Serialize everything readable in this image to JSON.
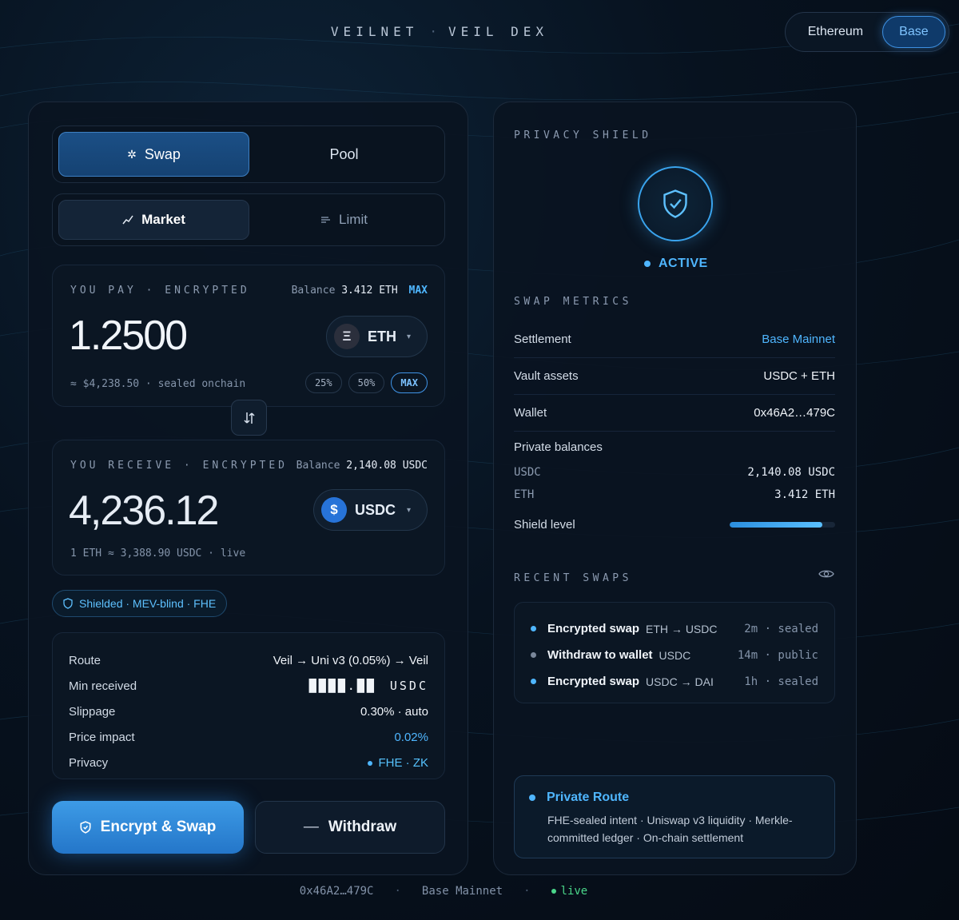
{
  "header": {
    "brand_left": "VEILNET",
    "brand_sep": "·",
    "brand_right": "VEIL DEX",
    "networks": [
      "Ethereum",
      "Base"
    ],
    "active_network": "Base"
  },
  "mode_tabs": {
    "swap": "Swap",
    "pool": "Pool"
  },
  "order_tabs": {
    "market": "Market",
    "limit": "Limit"
  },
  "pay": {
    "label": "YOU PAY · ENCRYPTED",
    "balance_label": "Balance",
    "balance_value": "3.412 ETH",
    "max": "MAX",
    "amount": "1.2500",
    "token": "ETH",
    "token_glyph": "Ξ",
    "usd_note": "≈ $4,238.50 · sealed onchain",
    "percents": [
      "25%",
      "50%",
      "MAX"
    ]
  },
  "receive": {
    "label": "YOU RECEIVE · ENCRYPTED",
    "balance_label": "Balance",
    "balance_value": "2,140.08 USDC",
    "amount": "4,236.12",
    "token": "USDC",
    "token_glyph": "$",
    "rate_note": "1 ETH ≈ 3,388.90 USDC · live"
  },
  "shield_tag": "Shielded · MEV-blind · FHE",
  "details": {
    "route_k": "Route",
    "route_v": "Veil → Uni v3 (0.05%) → Veil",
    "min_k": "Min received",
    "min_redacted": "████.██",
    "min_unit": "USDC",
    "slip_k": "Slippage",
    "slip_v": "0.30% · auto",
    "impact_k": "Price impact",
    "impact_v": "0.02%",
    "privacy_k": "Privacy",
    "privacy_v": "FHE · ZK"
  },
  "actions": {
    "encrypt_swap": "Encrypt & Swap",
    "withdraw": "Withdraw"
  },
  "privacy_shield": {
    "title": "PRIVACY SHIELD",
    "status": "ACTIVE",
    "shield_level": 0.88
  },
  "metrics": {
    "title": "SWAP METRICS",
    "settlement_k": "Settlement",
    "settlement_v": "Base Mainnet",
    "vault_k": "Vault assets",
    "vault_v": "USDC + ETH",
    "wallet_k": "Wallet",
    "wallet_v": "0x46A2…479C",
    "private_title": "Private balances",
    "usdc_k": "USDC",
    "usdc_v": "2,140.08 USDC",
    "eth_k": "ETH",
    "eth_v": "3.412 ETH",
    "shield_level_k": "Shield level"
  },
  "recent": {
    "title": "RECENT SWAPS",
    "items": [
      {
        "title": "Encrypted swap",
        "pair": "ETH → USDC",
        "meta": "2m · sealed",
        "color": "#4fb6ff"
      },
      {
        "title": "Withdraw to wallet",
        "pair": "USDC",
        "meta": "14m · public",
        "color": "#7a879a"
      },
      {
        "title": "Encrypted swap",
        "pair": "USDC → DAI",
        "meta": "1h · sealed",
        "color": "#4fb6ff"
      }
    ]
  },
  "private_route": {
    "title": "Private Route",
    "desc": "FHE-sealed intent · Uniswap v3 liquidity · Merkle-committed ledger · On-chain settlement"
  },
  "footer": {
    "wallet": "0x46A2…479C",
    "network": "Base Mainnet",
    "status": "live",
    "sep": "·"
  },
  "colors": {
    "accent": "#4fb6ff",
    "live": "#4ad68a",
    "primary_button": "#2f8ad8"
  }
}
